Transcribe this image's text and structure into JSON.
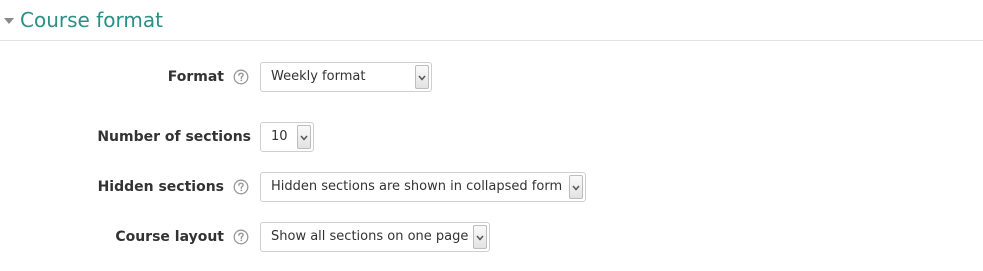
{
  "section": {
    "title": "Course format"
  },
  "fields": {
    "format": {
      "label": "Format",
      "value": "Weekly format"
    },
    "num_sections": {
      "label": "Number of sections",
      "value": "10"
    },
    "hidden_sections": {
      "label": "Hidden sections",
      "value": "Hidden sections are shown in collapsed form"
    },
    "course_layout": {
      "label": "Course layout",
      "value": "Show all sections on one page"
    }
  },
  "icons": {
    "collapse": "triangle-down-icon",
    "help": "question-circle-icon",
    "dropdown": "chevron-down-icon"
  },
  "colors": {
    "accent": "#2a8f85",
    "label": "#333333",
    "help_icon": "#999999"
  }
}
